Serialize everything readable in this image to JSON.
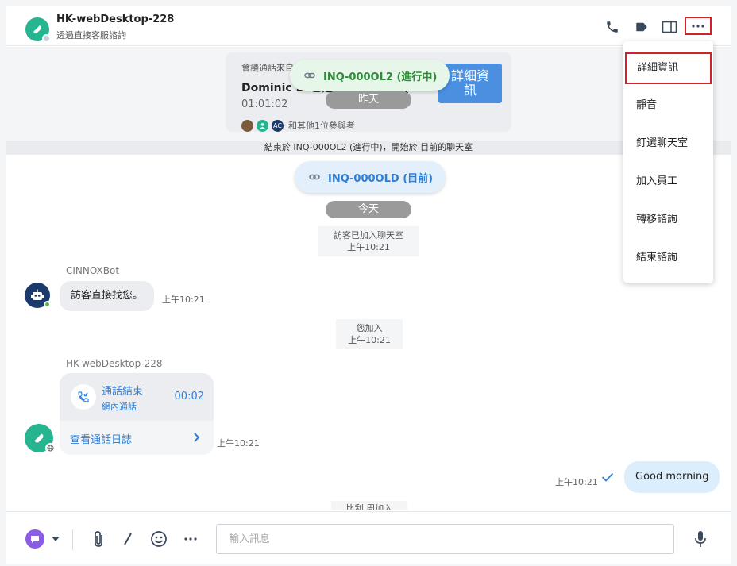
{
  "header": {
    "title": "HK-webDesktop-228",
    "subtitle": "透過直接客服諮詢"
  },
  "old_conversation": {
    "conference": {
      "label": "會議通話來自",
      "name": "Dominic L. 已通話的諮詢 (INQ-00...",
      "duration": "01:01:02",
      "participant_initials": "AC",
      "others": "和其他1位參與者",
      "details_button": "詳細資訊"
    },
    "inquiry_pill": "INQ-000OL2 (進行中)",
    "day_label": "昨天",
    "system_strip": "結束於 INQ-000OL2 (進行中)，開始於 目前的聊天室"
  },
  "current": {
    "inquiry_pill": "INQ-000OLD (目前)",
    "day_label": "今天",
    "visitor_joined": {
      "text": "訪客已加入聊天室",
      "time": "上午10:21"
    },
    "bot": {
      "name": "CINNOXBot",
      "message": "訪客直接找您。",
      "time": "上午10:21"
    },
    "you_joined": {
      "text": "您加入",
      "time": "上午10:21"
    },
    "agent": {
      "name": "HK-webDesktop-228",
      "call_title": "通話結束",
      "call_type": "網內通話",
      "call_duration": "00:02",
      "call_log_link": "查看通話日誌",
      "time": "上午10:21"
    },
    "outgoing": {
      "message": "Good morning",
      "time": "上午10:21"
    },
    "bottom_note": "比利 周加入"
  },
  "input": {
    "placeholder": "輸入訊息"
  },
  "menu": {
    "items": [
      "詳細資訊",
      "靜音",
      "釘選聊天室",
      "加入員工",
      "轉移諮詢",
      "結束諮詢"
    ]
  },
  "colors": {
    "accent": "#2f7fd6",
    "brand_green": "#26b58e",
    "highlight_red": "#d0202a",
    "bot_navy": "#1b3a6b"
  }
}
